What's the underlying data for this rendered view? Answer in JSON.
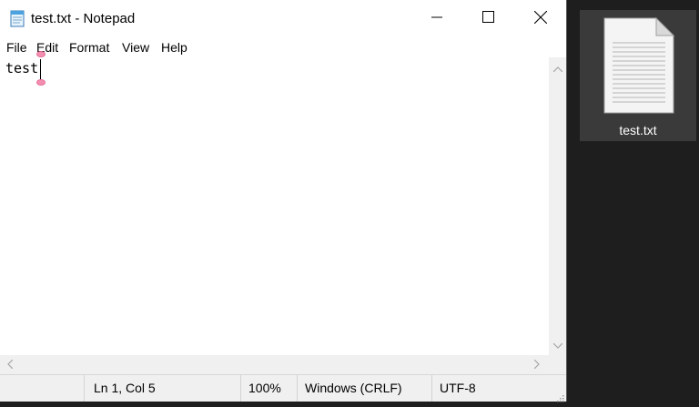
{
  "window": {
    "title": "test.txt - Notepad",
    "controls": {
      "minimize": "minimize-icon",
      "maximize": "maximize-icon",
      "close": "close-icon"
    }
  },
  "menu": {
    "items": [
      "File",
      "Edit",
      "Format",
      "View",
      "Help"
    ]
  },
  "editor": {
    "content": "test"
  },
  "status": {
    "position": "Ln 1, Col 5",
    "zoom": "100%",
    "line_ending": "Windows (CRLF)",
    "encoding": "UTF-8"
  },
  "desktop": {
    "file_name": "test.txt"
  },
  "colors": {
    "desktop_background": "#1e1e1e",
    "selected_icon_background": "#3a3a3a",
    "selection_handle": "#f48fb1"
  }
}
